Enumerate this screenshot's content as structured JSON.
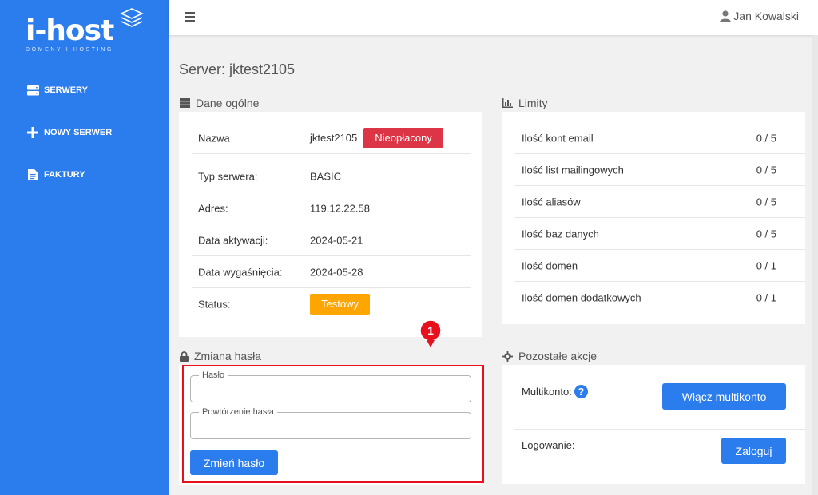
{
  "brand": {
    "name": "i-host",
    "tagline": "DOMENY I HOSTING"
  },
  "sidebar": {
    "items": [
      {
        "label": "SERWERY",
        "icon": "server-icon"
      },
      {
        "label": "NOWY SERWER",
        "icon": "plus-icon"
      },
      {
        "label": "FAKTURY",
        "icon": "document-icon"
      }
    ]
  },
  "topbar": {
    "user_name": "Jan Kowalski"
  },
  "page": {
    "title": "Server: jktest2105"
  },
  "general": {
    "title": "Dane ogólne",
    "rows": [
      {
        "label": "Nazwa",
        "value": "jktest2105"
      },
      {
        "label": "Typ serwera:",
        "value": "BASIC"
      },
      {
        "label": "Adres:",
        "value": "119.12.22.58"
      },
      {
        "label": "Data aktywacji:",
        "value": "2024-05-21"
      },
      {
        "label": "Data wygaśnięcia:",
        "value": "2024-05-28"
      },
      {
        "label": "Status:",
        "value": ""
      }
    ],
    "payment_badge": "Nieopłacony",
    "status_badge": "Testowy"
  },
  "limits": {
    "title": "Limity",
    "rows": [
      {
        "label": "Ilość kont email",
        "value": "0 / 5"
      },
      {
        "label": "Ilość list mailingowych",
        "value": "0 / 5"
      },
      {
        "label": "Ilość aliasów",
        "value": "0 / 5"
      },
      {
        "label": "Ilość baz danych",
        "value": "0 / 5"
      },
      {
        "label": "Ilość domen",
        "value": "0 / 1"
      },
      {
        "label": "Ilość domen dodatkowych",
        "value": "0 / 1"
      }
    ]
  },
  "password": {
    "title": "Zmiana hasła",
    "password_label": "Hasło",
    "password_value": "",
    "repeat_label": "Powtórzenie hasła",
    "repeat_value": "",
    "submit_label": "Zmień hasło"
  },
  "actions": {
    "title": "Pozostałe akcje",
    "multikonto_label": "Multikonto:",
    "multikonto_help": "?",
    "multikonto_button": "Włącz multikonto",
    "login_label": "Logowanie:",
    "login_button": "Zaloguj"
  },
  "annotation": {
    "marker_number": "1"
  },
  "colors": {
    "accent": "#2b7cec",
    "danger": "#dc3545",
    "warning": "#ffa500",
    "highlight": "#e8101d"
  }
}
